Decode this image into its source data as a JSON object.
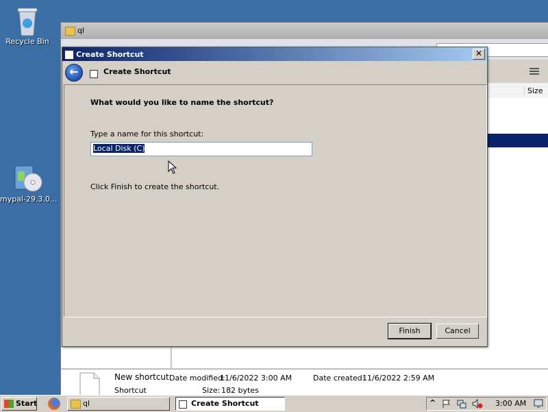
{
  "desktop": {
    "icons": [
      {
        "label": "Recycle Bin",
        "icon": "recycle-bin-icon"
      },
      {
        "label": "mypal-29.3.0...",
        "icon": "installer-icon"
      }
    ]
  },
  "explorer": {
    "title": "ql",
    "columns": {
      "size": "Size"
    },
    "details": {
      "name": "New shortcut",
      "type": "Shortcut",
      "modified_label": "Date modified:",
      "modified_value": "11/6/2022 3:00 AM",
      "created_label": "Date created:",
      "created_value": "11/6/2022 2:59 AM",
      "size_label": "Size:",
      "size_value": "182 bytes"
    }
  },
  "dialog": {
    "window_title": "Create Shortcut",
    "close_glyph": "✕",
    "header_title": "Create Shortcut",
    "back_glyph": "←",
    "question": "What would you like to name the shortcut?",
    "name_label": "Type a name for this shortcut:",
    "name_value": "Local Disk (C)",
    "finish_text": "Click Finish to create the shortcut.",
    "finish_button": "Finish",
    "cancel_button": "Cancel"
  },
  "taskbar": {
    "start_label": "Start",
    "tasks": [
      {
        "label": "ql",
        "icon": "folder-icon",
        "active": false
      },
      {
        "label": "Create Shortcut",
        "icon": "shortcut-icon",
        "active": true
      }
    ],
    "tray": {
      "chevron": "^",
      "clock": "3:00 AM"
    }
  }
}
